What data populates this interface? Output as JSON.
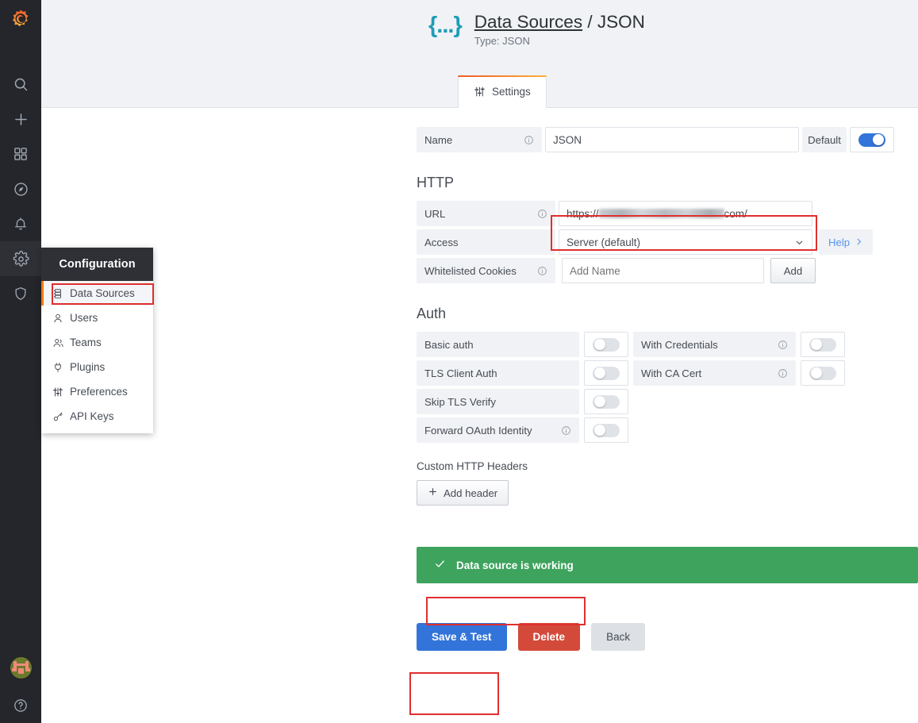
{
  "app": {
    "logo_icon": "grafana-logo-icon",
    "brand_colors": {
      "accent_orange": "#ff780a",
      "primary_blue": "#3274d9",
      "success_green": "#3da35d",
      "danger_red": "#d44a3a",
      "highlight_red": "#e02f2f"
    }
  },
  "rail": {
    "items": [
      {
        "icon": "search-icon",
        "name": "search"
      },
      {
        "icon": "plus-icon",
        "name": "create"
      },
      {
        "icon": "dashboards-grid-icon",
        "name": "dashboards"
      },
      {
        "icon": "compass-explore-icon",
        "name": "explore"
      },
      {
        "icon": "bell-alerting-icon",
        "name": "alerting"
      },
      {
        "icon": "gear-configuration-icon",
        "name": "configuration",
        "active": true
      },
      {
        "icon": "shield-admin-icon",
        "name": "server-admin"
      }
    ],
    "avatar_icon": "user-avatar",
    "help_icon": "help-question-icon"
  },
  "config_menu": {
    "title": "Configuration",
    "items": [
      {
        "label": "Data Sources",
        "icon": "database-icon",
        "selected": true
      },
      {
        "label": "Users",
        "icon": "user-icon",
        "selected": false
      },
      {
        "label": "Teams",
        "icon": "users-group-icon",
        "selected": false
      },
      {
        "label": "Plugins",
        "icon": "plug-icon",
        "selected": false
      },
      {
        "label": "Preferences",
        "icon": "sliders-icon",
        "selected": false
      },
      {
        "label": "API Keys",
        "icon": "key-icon",
        "selected": false
      }
    ]
  },
  "header": {
    "icon": "json-braces-icon",
    "icon_text": "{...}",
    "breadcrumb_link": "Data Sources",
    "breadcrumb_separator": "/",
    "breadcrumb_current": "JSON",
    "subtitle": "Type: JSON",
    "tabs": [
      {
        "label": "Settings",
        "icon": "sliders-icon",
        "active": true
      }
    ]
  },
  "form": {
    "name_row": {
      "label": "Name",
      "info_icon": "info-circle-icon",
      "value": "JSON",
      "default_label": "Default",
      "default_toggle_on": true
    },
    "http_section": {
      "title": "HTTP",
      "url_row": {
        "label": "URL",
        "info_icon": "info-circle-icon",
        "value_prefix": "https://",
        "value_redacted": true,
        "value_suffix": "com/"
      },
      "access_row": {
        "label": "Access",
        "value": "Server (default)",
        "caret_icon": "chevron-down-icon",
        "help_label": "Help",
        "help_caret_icon": "chevron-right-icon"
      },
      "cookies_row": {
        "label": "Whitelisted Cookies",
        "info_icon": "info-circle-icon",
        "placeholder": "Add Name",
        "value": "",
        "add_button": "Add"
      }
    },
    "auth_section": {
      "title": "Auth",
      "rows": [
        {
          "left_label": "Basic auth",
          "left_info": false,
          "left_on": false,
          "right_label": "With Credentials",
          "right_info": true,
          "right_on": false
        },
        {
          "left_label": "TLS Client Auth",
          "left_info": false,
          "left_on": false,
          "right_label": "With CA Cert",
          "right_info": true,
          "right_on": false
        },
        {
          "left_label": "Skip TLS Verify",
          "left_info": false,
          "left_on": false,
          "right_label": null,
          "right_info": false,
          "right_on": false
        },
        {
          "left_label": "Forward OAuth Identity",
          "left_info": true,
          "left_on": false,
          "right_label": null,
          "right_info": false,
          "right_on": false
        }
      ]
    },
    "headers_section": {
      "title": "Custom HTTP Headers",
      "add_header_button": "Add header",
      "add_header_icon": "plus-icon"
    },
    "status_alert": {
      "icon": "check-icon",
      "message": "Data source is working",
      "color": "#3da35d"
    },
    "actions": {
      "save_label": "Save & Test",
      "delete_label": "Delete",
      "back_label": "Back"
    }
  }
}
